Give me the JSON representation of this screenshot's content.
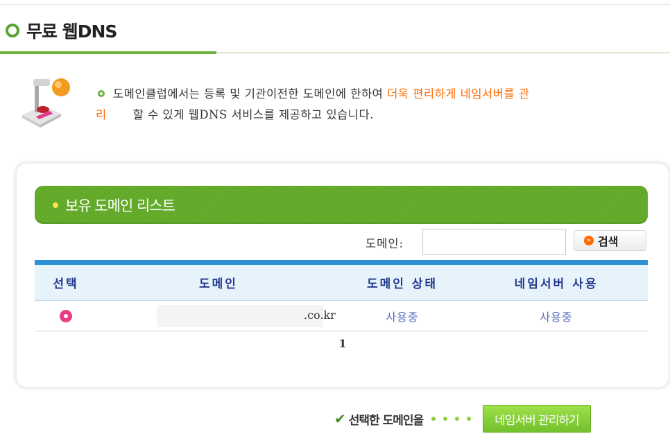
{
  "header": {
    "title": "무료 웹DNS"
  },
  "intro": {
    "text_before": "도메인클럽에서는 등록 및 기관이전한 도메인에 한하여 ",
    "highlight_1": "더욱 편리하게 네임서버를 관",
    "highlight_2": "리",
    "text_after": "할 수 있게 웹DNS 서비스를 제공하고 있습니다."
  },
  "list": {
    "title": "보유 도메인 리스트",
    "search": {
      "label": "도메인:",
      "value": "",
      "placeholder": "",
      "button_label": "검색"
    },
    "columns": [
      "선택",
      "도메인",
      "도메인 상태",
      "네임서버 사용"
    ],
    "rows": [
      {
        "domain_suffix": ".co.kr",
        "domain_status": "사용중",
        "nameserver_use": "사용중"
      }
    ],
    "page": "1"
  },
  "action": {
    "label": "선택한 도메인을",
    "button_label": "네임서버 관리하기"
  },
  "colors": {
    "brand_green": "#6cb23f",
    "table_blue": "#2d8fd6",
    "highlight_orange": "#ff6a00",
    "radio_pink": "#ea3d87"
  }
}
